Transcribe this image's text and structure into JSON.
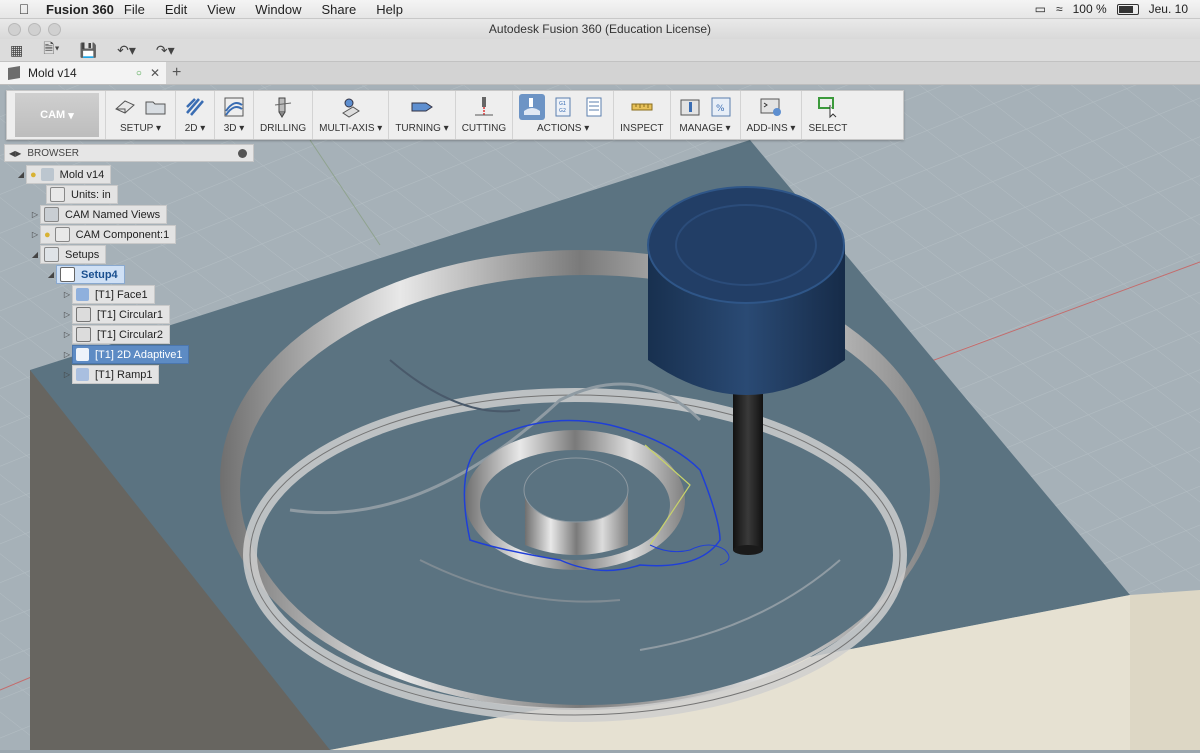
{
  "menubar": {
    "app_name": "Fusion 360",
    "menus": [
      "File",
      "Edit",
      "View",
      "Window",
      "Share",
      "Help"
    ],
    "battery": "100 %",
    "clock": "Jeu. 10"
  },
  "window": {
    "title": "Autodesk Fusion 360 (Education License)"
  },
  "tabs": {
    "document_name": "Mold v14",
    "add": "+"
  },
  "ribbon": {
    "workspace": "CAM",
    "groups": [
      {
        "label": "SETUP",
        "dropdown": true
      },
      {
        "label": "2D",
        "dropdown": true
      },
      {
        "label": "3D",
        "dropdown": true
      },
      {
        "label": "DRILLING",
        "dropdown": false
      },
      {
        "label": "MULTI-AXIS",
        "dropdown": true
      },
      {
        "label": "TURNING",
        "dropdown": true
      },
      {
        "label": "CUTTING",
        "dropdown": false
      },
      {
        "label": "ACTIONS",
        "dropdown": true
      },
      {
        "label": "INSPECT",
        "dropdown": false
      },
      {
        "label": "MANAGE",
        "dropdown": true
      },
      {
        "label": "ADD-INS",
        "dropdown": true
      },
      {
        "label": "SELECT",
        "dropdown": false
      }
    ]
  },
  "browser": {
    "title": "BROWSER",
    "root": "Mold v14",
    "units": "Units: in",
    "named_views": "CAM Named Views",
    "component": "CAM Component:1",
    "setups": "Setups",
    "setup": "Setup4",
    "operations": [
      "[T1] Face1",
      "[T1] Circular1",
      "[T1] Circular2",
      "[T1] 2D Adaptive1",
      "[T1] Ramp1"
    ],
    "selected_operation": "[T1] 2D Adaptive1"
  },
  "colors": {
    "stock_top": "#5b7381",
    "toolpath": "#1f3fd8",
    "tool_holder": "#1f3b5e",
    "selection": "#5d8bc4"
  }
}
